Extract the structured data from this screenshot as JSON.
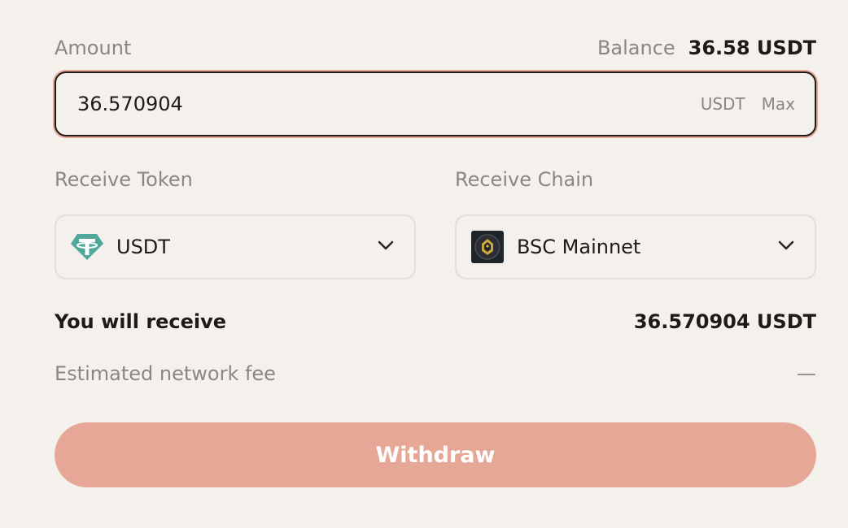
{
  "amount": {
    "label": "Amount",
    "balance_label": "Balance",
    "balance_value": "36.58 USDT",
    "input_value": "36.570904",
    "unit": "USDT",
    "max_label": "Max"
  },
  "receive_token": {
    "label": "Receive Token",
    "selected": "USDT",
    "icon": "tether-icon"
  },
  "receive_chain": {
    "label": "Receive Chain",
    "selected": "BSC Mainnet",
    "icon": "bnb-chain-icon"
  },
  "summary": {
    "receive_label": "You will receive",
    "receive_value": "36.570904 USDT",
    "fee_label": "Estimated network fee",
    "fee_value": "—"
  },
  "withdraw_label": "Withdraw",
  "colors": {
    "background": "#f4f0eb",
    "accent": "#e6a797",
    "tether_teal": "#4fa89a",
    "muted_text": "#8d8680"
  }
}
